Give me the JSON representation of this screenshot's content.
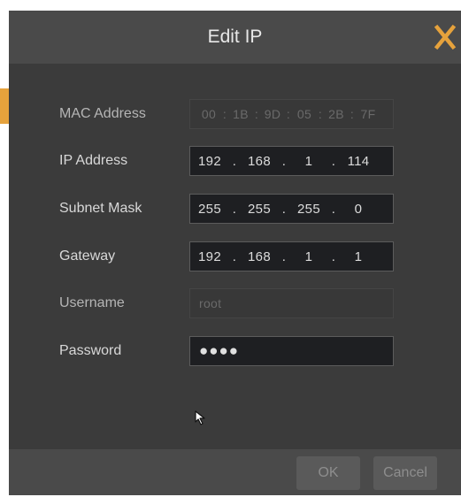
{
  "dialog": {
    "title": "Edit IP"
  },
  "fields": {
    "mac": {
      "label": "MAC Address",
      "parts": [
        "00",
        "1B",
        "9D",
        "05",
        "2B",
        "7F"
      ],
      "separator": ":"
    },
    "ip": {
      "label": "IP Address",
      "octets": [
        "192",
        "168",
        "1",
        "114"
      ]
    },
    "subnet": {
      "label": "Subnet Mask",
      "octets": [
        "255",
        "255",
        "255",
        "0"
      ]
    },
    "gateway": {
      "label": "Gateway",
      "octets": [
        "192",
        "168",
        "1",
        "1"
      ]
    },
    "username": {
      "label": "Username",
      "value": "root"
    },
    "password": {
      "label": "Password",
      "masked": "●●●●"
    }
  },
  "octet_separator": ".",
  "buttons": {
    "ok": "OK",
    "cancel": "Cancel"
  },
  "colors": {
    "accent": "#e6a23c",
    "dialog_bg": "#3b3b3b",
    "titlebar_bg": "#4a4a4a",
    "field_bg": "#1e1f22"
  }
}
